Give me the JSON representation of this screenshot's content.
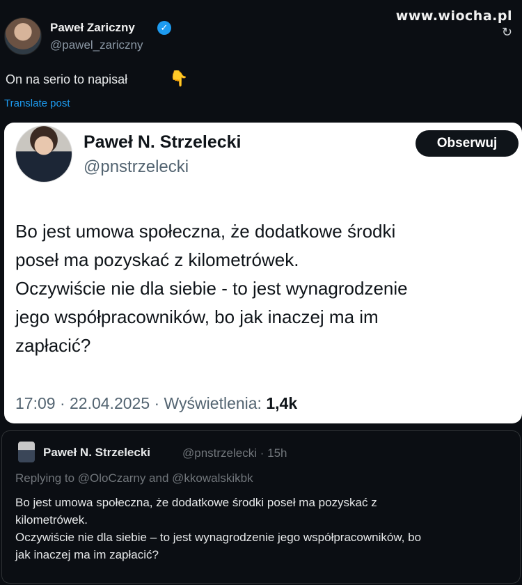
{
  "watermark": "www.wiocha.pl",
  "author": {
    "name": "Paweł Zariczny",
    "handle": "@pawel_zariczny",
    "verified_glyph": "✓"
  },
  "post": {
    "text": "On na serio to napisał",
    "emoji": "👇",
    "translate": "Translate post"
  },
  "embedded": {
    "name": "Paweł N. Strzelecki",
    "handle": "@pnstrzelecki",
    "follow": "Obserwuj",
    "body": [
      "Bo jest umowa społeczna, że dodatkowe środki",
      "poseł ma pozyskać z kilometrówek.",
      "Oczywiście nie dla siebie - to jest wynagrodzenie",
      "jego współpracowników, bo jak inaczej ma im",
      "zapłacić?"
    ],
    "meta_prefix": "17:09 · 22.04.2025 · Wyświetlenia: ",
    "views": "1,4k"
  },
  "reply": {
    "name": "Paweł N. Strzelecki",
    "handle_time": "@pnstrzelecki · 15h",
    "replying": "Replying to @OloCzarny and @kkowalskikbk",
    "body": [
      "Bo jest umowa społeczna, że dodatkowe środki poseł ma pozyskać z",
      "kilometrówek.",
      "Oczywiście nie dla siebie – to jest wynagrodzenie jego współpracowników, bo",
      "jak inaczej ma im zapłacić?"
    ]
  },
  "icons": {
    "repost": "↻"
  }
}
